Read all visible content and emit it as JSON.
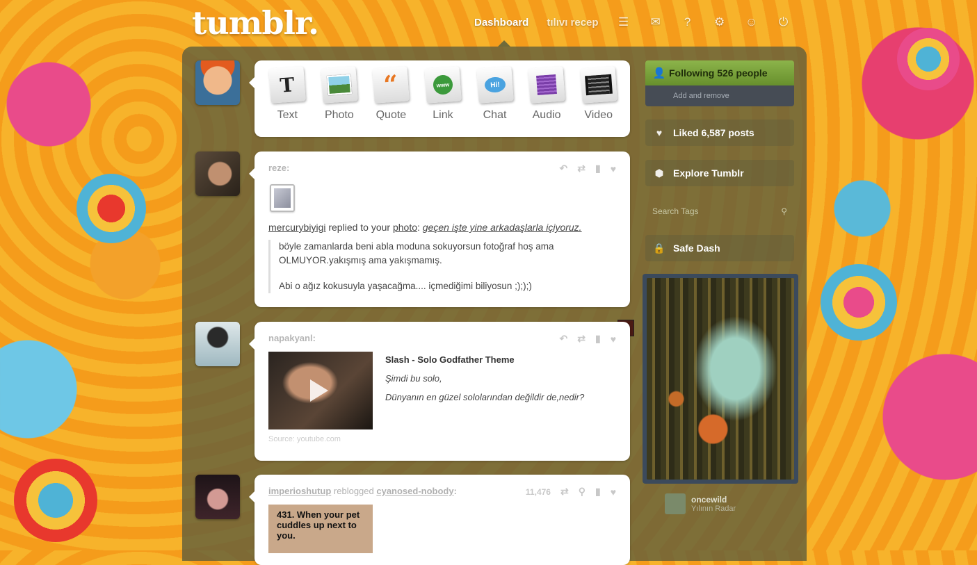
{
  "header": {
    "logo": "tumblr.",
    "nav": {
      "dashboard": "Dashboard",
      "second": "tılıvı recep"
    },
    "icons": [
      "inbox-icon",
      "mail-icon",
      "help-icon",
      "settings-icon",
      "account-icon",
      "power-icon"
    ]
  },
  "composer": {
    "types": [
      {
        "label": "Text"
      },
      {
        "label": "Photo"
      },
      {
        "label": "Quote"
      },
      {
        "label": "Link"
      },
      {
        "label": "Chat"
      },
      {
        "label": "Audio"
      },
      {
        "label": "Video"
      }
    ]
  },
  "posts": [
    {
      "author": "reze:",
      "replier": "mercurybiyigi",
      "reply_text": "replied to your",
      "reply_target": "photo",
      "reply_quote": "geçen işte yine arkadaşlarla içiyoruz.",
      "line1": "böyle zamanlarda beni abla moduna sokuyorsun fotoğraf hoş ama",
      "line2": "OLMUYOR.yakışmış ama yakışmamış.",
      "line3": "Abi o ağız kokusuyla yaşacağma.... içmediğimi biliyosun ;););)"
    },
    {
      "author": "napakyanl:",
      "title": "Slash - Solo Godfather Theme",
      "text1": "Şimdi bu solo,",
      "text2": "Dünyanın en güzel sololarından değildir de,nedir?",
      "source": "Source: youtube.com"
    },
    {
      "author": "imperioshutup",
      "reblogged": "reblogged",
      "reblog_source": "cyanosed-nobody",
      "colon": ":",
      "notes": "11,476",
      "image_text": "431. When your pet cuddles up next to you."
    }
  ],
  "sidebar": {
    "following": "Following 526 people",
    "add_remove": "Add and remove",
    "liked": "Liked 6,587 posts",
    "explore": "Explore Tumblr",
    "search_placeholder": "Search Tags",
    "safe": "Safe Dash",
    "radar_user": "oncewild",
    "radar_sub": "Yılının Radar"
  },
  "colors": {
    "accent_green": "#7ea53d",
    "panel": "#5c5c3c"
  }
}
